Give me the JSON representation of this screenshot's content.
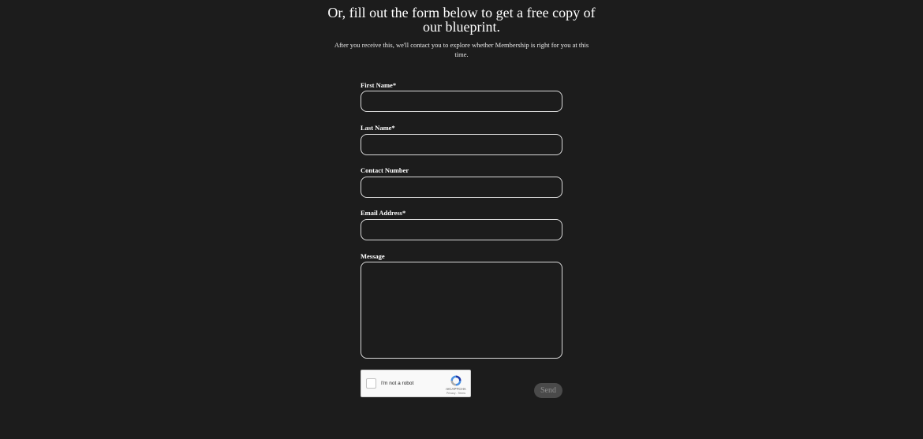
{
  "header": {
    "headline": "Or, fill out the form below to get a free copy of our blueprint.",
    "subtext": "After you receive this, we'll contact you to explore whether Membership is right for you at this time."
  },
  "form": {
    "first_name_label": "First Name*",
    "first_name_value": "",
    "last_name_label": "Last Name*",
    "last_name_value": "",
    "contact_number_label": "Contact Number",
    "contact_number_value": "",
    "email_label": "Email Address*",
    "email_value": "",
    "message_label": "Message",
    "message_value": "",
    "send_label": "Send"
  },
  "recaptcha": {
    "label": "I'm not a robot",
    "brand": "reCAPTCHA",
    "terms": "Privacy - Terms",
    "checked": false
  },
  "colors": {
    "background": "#1c1c1c",
    "text": "#ffffff",
    "field_border": "#d9d9d9",
    "send_button_bg": "#4a4a4a",
    "send_button_text": "#8f8f8f"
  },
  "icons": {
    "recaptcha_logo": "recaptcha-logo-icon"
  }
}
